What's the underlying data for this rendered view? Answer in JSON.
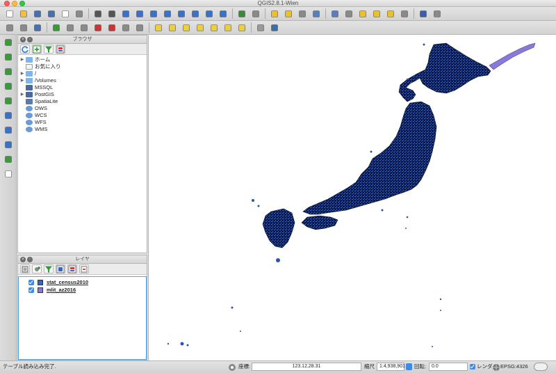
{
  "window": {
    "title": "QGIS2.8.1-Wien"
  },
  "toolbar_top": [
    {
      "icon": "new-project-icon"
    },
    {
      "icon": "open-project-icon"
    },
    {
      "icon": "save-project-icon"
    },
    {
      "icon": "save-as-icon"
    },
    {
      "icon": "new-print-composer-icon"
    },
    {
      "icon": "composer-manager-icon"
    },
    {
      "icon": "pan-hand-icon"
    },
    {
      "icon": "pan-to-selection-icon"
    },
    {
      "icon": "zoom-in-icon"
    },
    {
      "icon": "zoom-out-icon"
    },
    {
      "icon": "zoom-native-icon"
    },
    {
      "icon": "zoom-full-icon"
    },
    {
      "icon": "zoom-to-selection-icon"
    },
    {
      "icon": "zoom-to-layer-icon"
    },
    {
      "icon": "zoom-last-icon"
    },
    {
      "icon": "zoom-next-icon"
    },
    {
      "icon": "refresh-icon"
    },
    {
      "icon": "identify-icon"
    },
    {
      "icon": "select-features-icon"
    },
    {
      "icon": "deselect-icon"
    },
    {
      "icon": "field-calculator-icon"
    },
    {
      "icon": "attribute-table-icon"
    },
    {
      "icon": "statistics-icon"
    },
    {
      "icon": "measure-icon"
    },
    {
      "icon": "map-tips-icon"
    },
    {
      "icon": "new-bookmark-icon"
    },
    {
      "icon": "show-bookmarks-icon"
    },
    {
      "icon": "text-annotation-icon"
    },
    {
      "icon": "help-icon"
    },
    {
      "icon": "whats-this-icon"
    }
  ],
  "toolbar_second": [
    {
      "icon": "toggle-editing-pencil-icon"
    },
    {
      "icon": "current-edits-icon"
    },
    {
      "icon": "save-layer-edits-icon"
    },
    {
      "icon": "add-feature-icon"
    },
    {
      "icon": "move-feature-icon"
    },
    {
      "icon": "node-tool-icon"
    },
    {
      "icon": "delete-selected-icon"
    },
    {
      "icon": "cut-features-icon"
    },
    {
      "icon": "copy-features-icon"
    },
    {
      "icon": "paste-features-icon"
    },
    {
      "icon": "label-abc-icon"
    },
    {
      "icon": "label-tool-icon"
    },
    {
      "icon": "pin-labels-icon"
    },
    {
      "icon": "show-hide-labels-icon"
    },
    {
      "icon": "move-label-icon"
    },
    {
      "icon": "rotate-label-icon"
    },
    {
      "icon": "change-label-icon"
    },
    {
      "icon": "csw-icon"
    },
    {
      "icon": "python-console-icon"
    }
  ],
  "left_toolbar": [
    {
      "icon": "add-vector-layer-icon"
    },
    {
      "icon": "add-raster-layer-icon"
    },
    {
      "icon": "add-postgis-layer-icon"
    },
    {
      "icon": "add-spatialite-layer-icon"
    },
    {
      "icon": "add-mssql-layer-icon"
    },
    {
      "icon": "add-wms-layer-icon"
    },
    {
      "icon": "add-wcs-layer-icon"
    },
    {
      "icon": "add-wfs-layer-icon"
    },
    {
      "icon": "add-delimited-text-icon"
    },
    {
      "icon": "new-shapefile-icon"
    }
  ],
  "browser_panel": {
    "title": "ブラウザ",
    "items": [
      {
        "label": "ホーム",
        "icon": "folder-icon",
        "expandable": true
      },
      {
        "label": "お気に入り",
        "icon": "favorites-star-icon",
        "expandable": false
      },
      {
        "label": "/",
        "icon": "folder-icon",
        "expandable": true
      },
      {
        "label": "/Volumes",
        "icon": "folder-icon",
        "expandable": true
      },
      {
        "label": "MSSQL",
        "icon": "mssql-icon",
        "expandable": false
      },
      {
        "label": "PostGIS",
        "icon": "postgis-elephant-icon",
        "expandable": true
      },
      {
        "label": "SpatiaLite",
        "icon": "spatialite-feather-icon",
        "expandable": false
      },
      {
        "label": "OWS",
        "icon": "ows-globe-icon",
        "expandable": false
      },
      {
        "label": "WCS",
        "icon": "wcs-globe-icon",
        "expandable": false
      },
      {
        "label": "WFS",
        "icon": "wfs-globe-icon",
        "expandable": false
      },
      {
        "label": "WMS",
        "icon": "wms-globe-icon",
        "expandable": false
      }
    ]
  },
  "layers_panel": {
    "title": "レイヤ",
    "layers": [
      {
        "name": "stat_census2010",
        "color": "#3564c8",
        "checked": true
      },
      {
        "name": "mlit_az2016",
        "color": "#8a79d8",
        "checked": true
      }
    ]
  },
  "map": {
    "fill_main": "#1b2140",
    "fill_hokkaido_east": "#8a79d8",
    "accent": "#3a66d6"
  },
  "statusbar": {
    "message": "テーブル読み込み完了.",
    "coord_label": "座標:",
    "coord_value": "123.12,28.31",
    "scale_label": "縮尺",
    "scale_value": "1:4,938,901",
    "rotation_label": "回転:",
    "rotation_value": "0.0",
    "render_label": "レンダ",
    "crs": "EPSG:4326"
  }
}
